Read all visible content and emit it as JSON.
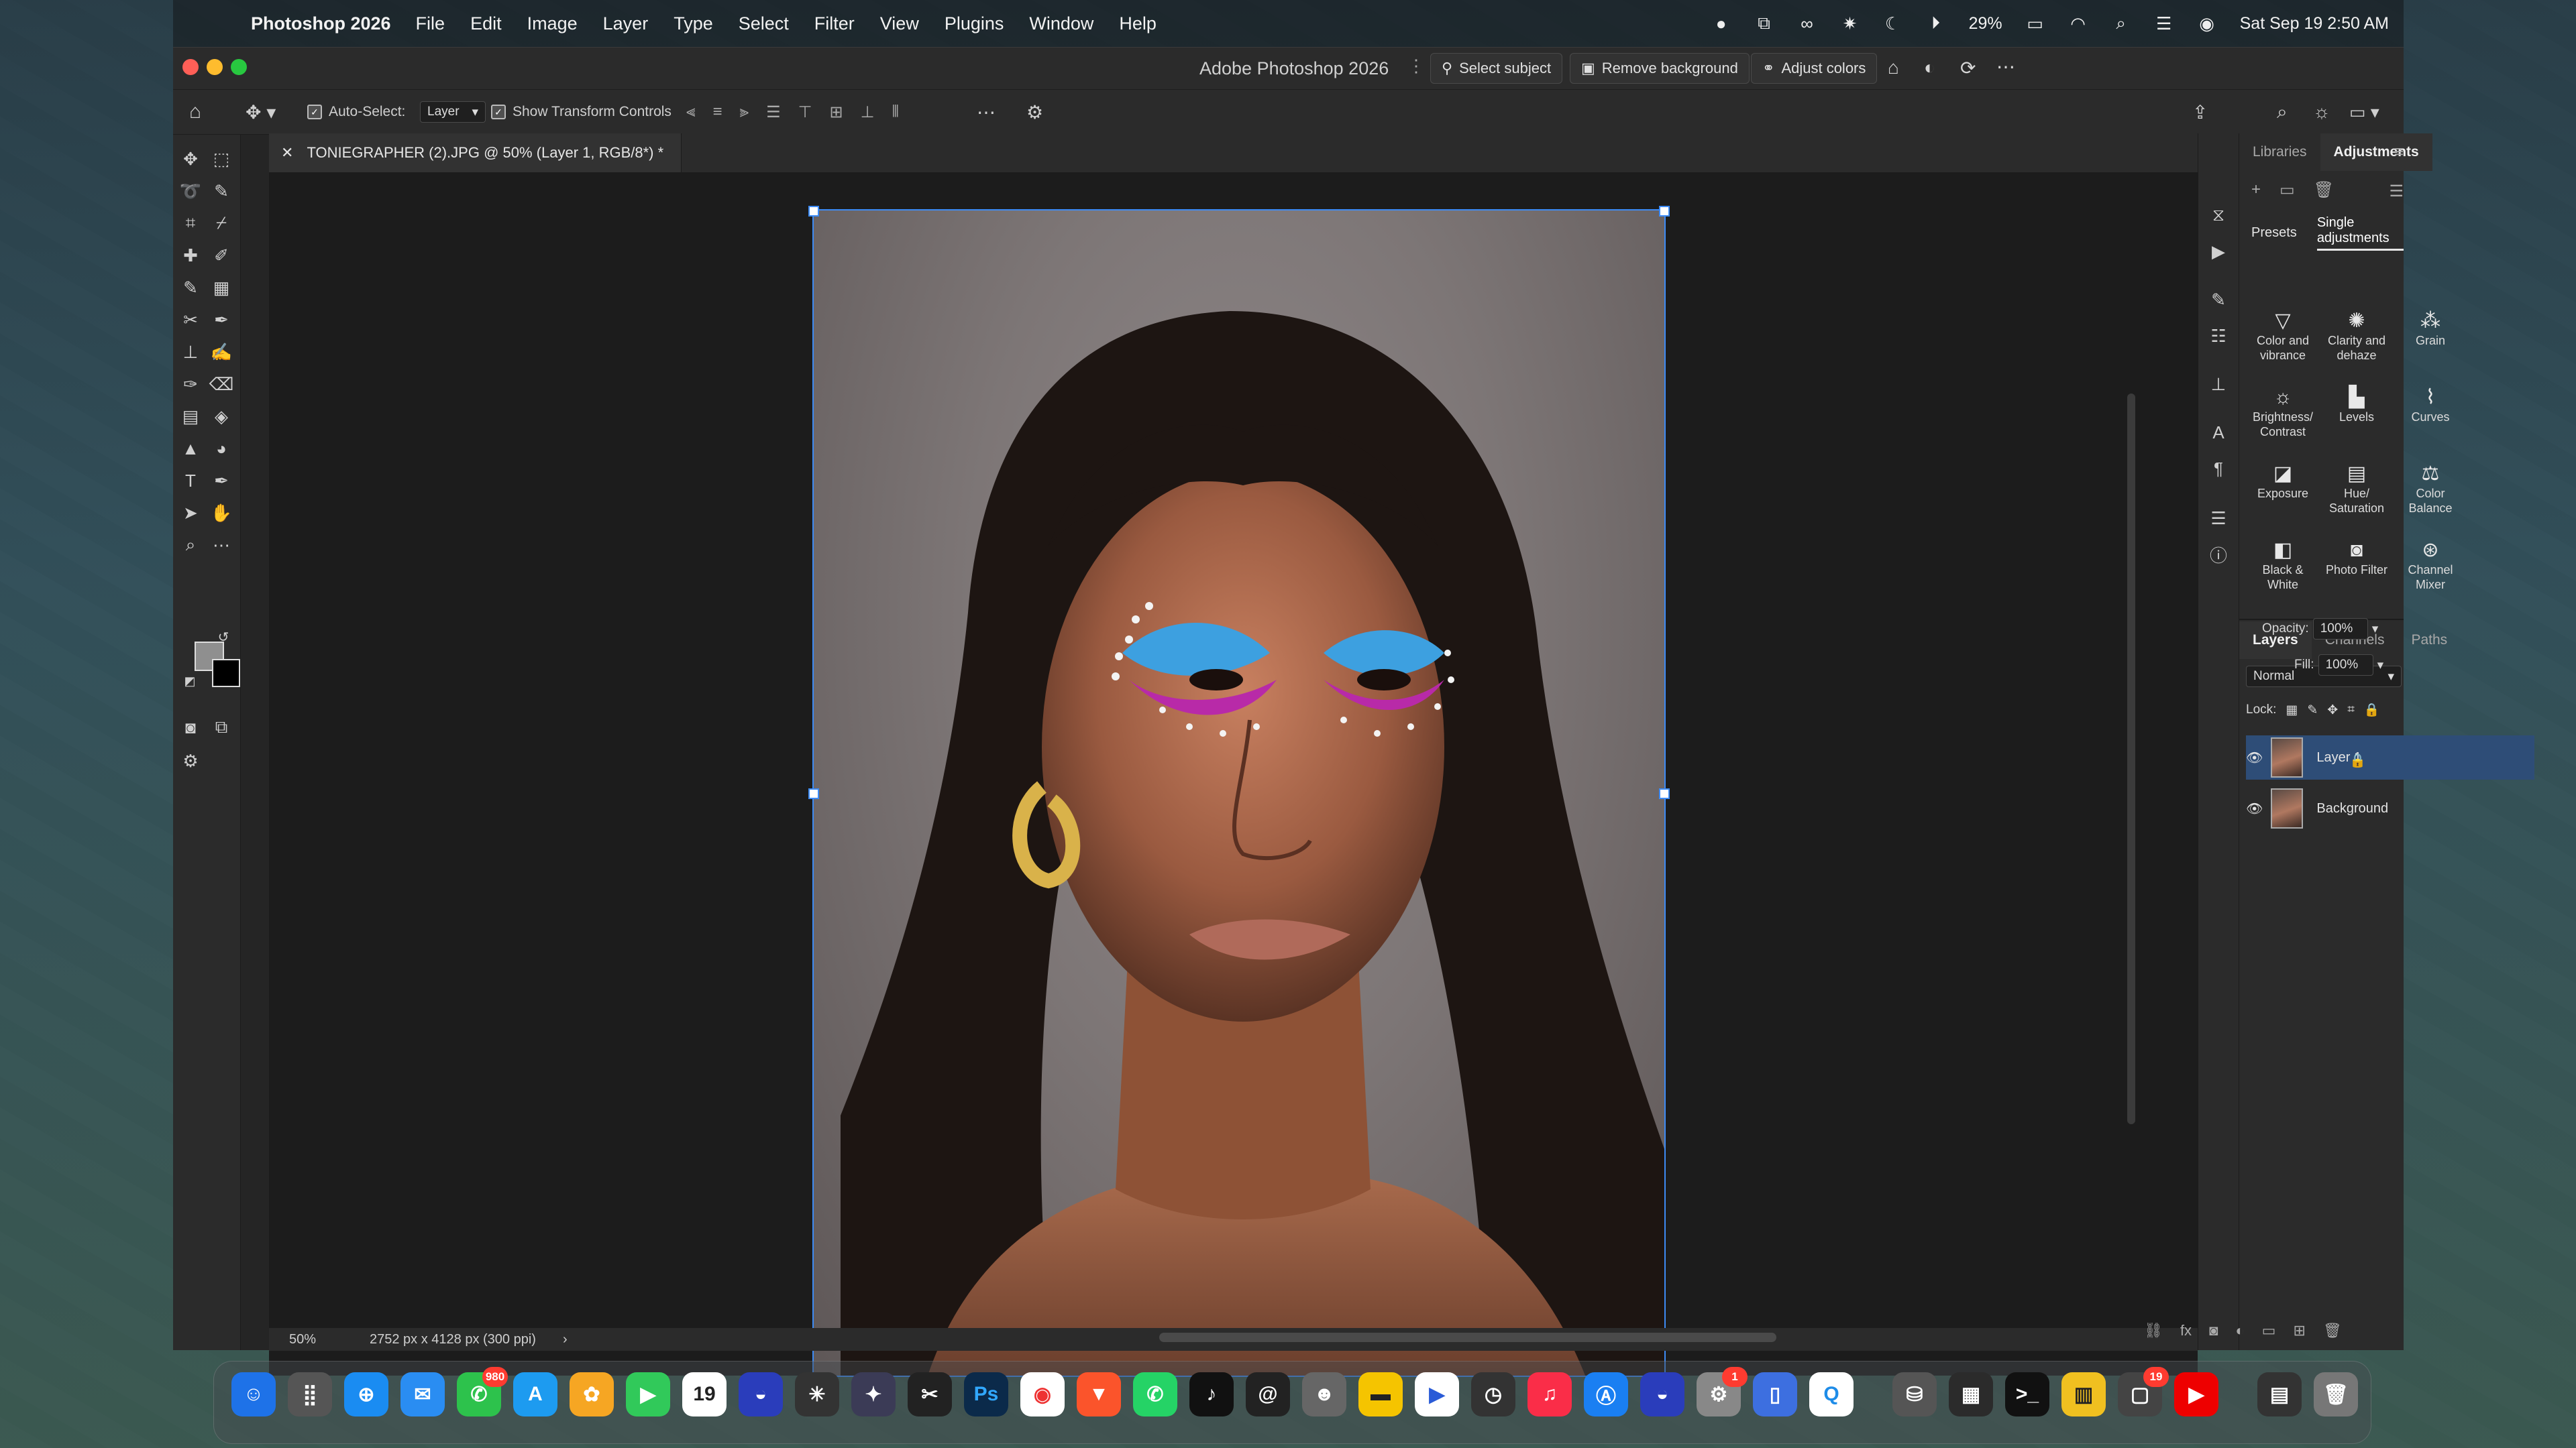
{
  "menubar": {
    "app_name": "Photoshop 2026",
    "items": [
      "File",
      "Edit",
      "Image",
      "Layer",
      "Type",
      "Select",
      "Filter",
      "View",
      "Plugins",
      "Window",
      "Help"
    ],
    "battery": "29%",
    "datetime": "Sat Sep 19  2:50 AM"
  },
  "window": {
    "title": "Adobe Photoshop 2026",
    "quick_actions": {
      "select_subject": "Select subject",
      "remove_background": "Remove background",
      "adjust_colors": "Adjust colors"
    }
  },
  "options_bar": {
    "auto_select_label": "Auto-Select:",
    "auto_select_value": "Layer",
    "show_transform_label": "Show Transform Controls"
  },
  "document": {
    "tab_title": "TONIEGRAPHER (2).JPG @ 50% (Layer 1, RGB/8*) *",
    "zoom": "50%",
    "info": "2752 px x 4128 px (300 ppi)"
  },
  "panels": {
    "top_tabs": [
      "Libraries",
      "Adjustments"
    ],
    "sub_tabs": [
      "Presets",
      "Single adjustments"
    ],
    "adjustments": [
      {
        "label": "Color and vibrance",
        "icon": "triangle-icon"
      },
      {
        "label": "Clarity and dehaze",
        "icon": "sparkle-icon"
      },
      {
        "label": "Grain",
        "icon": "grain-icon"
      },
      {
        "label": "Brightness/ Contrast",
        "icon": "sun-icon"
      },
      {
        "label": "Levels",
        "icon": "levels-icon"
      },
      {
        "label": "Curves",
        "icon": "curves-icon"
      },
      {
        "label": "Exposure",
        "icon": "exposure-icon"
      },
      {
        "label": "Hue/ Saturation",
        "icon": "hue-icon"
      },
      {
        "label": "Color Balance",
        "icon": "balance-icon"
      },
      {
        "label": "Black & White",
        "icon": "bw-icon"
      },
      {
        "label": "Photo Filter",
        "icon": "camera-icon"
      },
      {
        "label": "Channel Mixer",
        "icon": "mixer-icon"
      }
    ],
    "layers_tabs": [
      "Layers",
      "Channels",
      "Paths"
    ],
    "blend_mode": "Normal",
    "opacity_label": "Opacity:",
    "opacity_value": "100%",
    "lock_label": "Lock:",
    "fill_label": "Fill:",
    "fill_value": "100%",
    "layers": [
      {
        "name": "Layer 1",
        "selected": true
      },
      {
        "name": "Background",
        "selected": false
      }
    ]
  },
  "dock": {
    "messages_badge": "980",
    "calendar_day": "19",
    "settings_badge": "1",
    "photoshop_label": "Ps",
    "iphone_mirror_badge": "19"
  },
  "colors": {
    "accent": "#3d8bf5",
    "selected_layer": "#2e4d77"
  }
}
